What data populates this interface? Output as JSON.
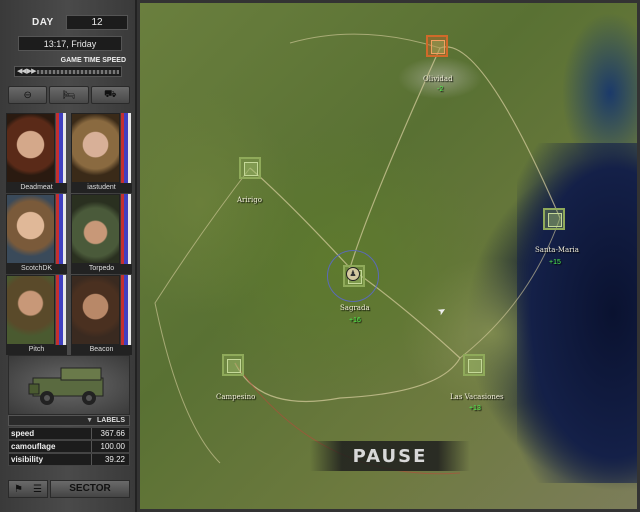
{
  "sidebar": {
    "day_label": "DAY",
    "day_value": "12",
    "time": "13:17, Friday",
    "speed_label": "GAME TIME SPEED",
    "mercs": [
      {
        "name": "Deadmeat",
        "bars": [
          "#c43030",
          "#4040c0",
          "#e8e8e8"
        ]
      },
      {
        "name": "iastudent",
        "bars": [
          "#c43030",
          "#4040c0",
          "#e8e8e8"
        ]
      },
      {
        "name": "ScotchDK",
        "bars": [
          "#c43030",
          "#4040c0",
          "#e8e8e8"
        ]
      },
      {
        "name": "Torpedo",
        "bars": [
          "#c43030",
          "#4040c0",
          "#e8e8e8"
        ]
      },
      {
        "name": "Pitch",
        "bars": [
          "#c43030",
          "#4040c0",
          "#e8e8e8"
        ]
      },
      {
        "name": "Beacon",
        "bars": [
          "#c43030",
          "#4040c0",
          "#e8e8e8"
        ]
      }
    ],
    "labels_title": "LABELS",
    "stats": [
      {
        "label": "speed",
        "value": "367.66"
      },
      {
        "label": "camouflage",
        "value": "100.00"
      },
      {
        "label": "visibility",
        "value": "39.22"
      }
    ],
    "sector_label": "SECTOR"
  },
  "map": {
    "towns": [
      {
        "name": "Olividad",
        "count": "-2",
        "owner": "enemy"
      },
      {
        "name": "Aririgo",
        "count": "",
        "owner": "ally"
      },
      {
        "name": "Santa-Maria",
        "count": "+15",
        "owner": "ally"
      },
      {
        "name": "Sagrada",
        "count": "+16",
        "owner": "ally"
      },
      {
        "name": "Campesino",
        "count": "",
        "owner": "ally"
      },
      {
        "name": "Las Vacasiones",
        "count": "+13",
        "owner": "ally"
      }
    ],
    "status": "PAUSE"
  }
}
